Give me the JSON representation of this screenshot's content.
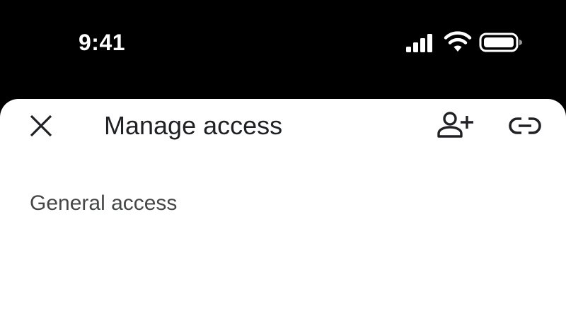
{
  "status_bar": {
    "time": "9:41",
    "icons": [
      "cellular-signal-icon",
      "wifi-icon",
      "battery-icon"
    ]
  },
  "sheet": {
    "title": "Manage access",
    "actions": {
      "close_icon": "close-icon",
      "add_person_icon": "add-person-icon",
      "link_icon": "link-icon"
    },
    "sections": [
      {
        "heading": "General access"
      }
    ]
  },
  "colors": {
    "status_bar_background": "#000000",
    "sheet_background": "#ffffff",
    "title_text": "#202124",
    "section_heading_text": "#444746"
  }
}
